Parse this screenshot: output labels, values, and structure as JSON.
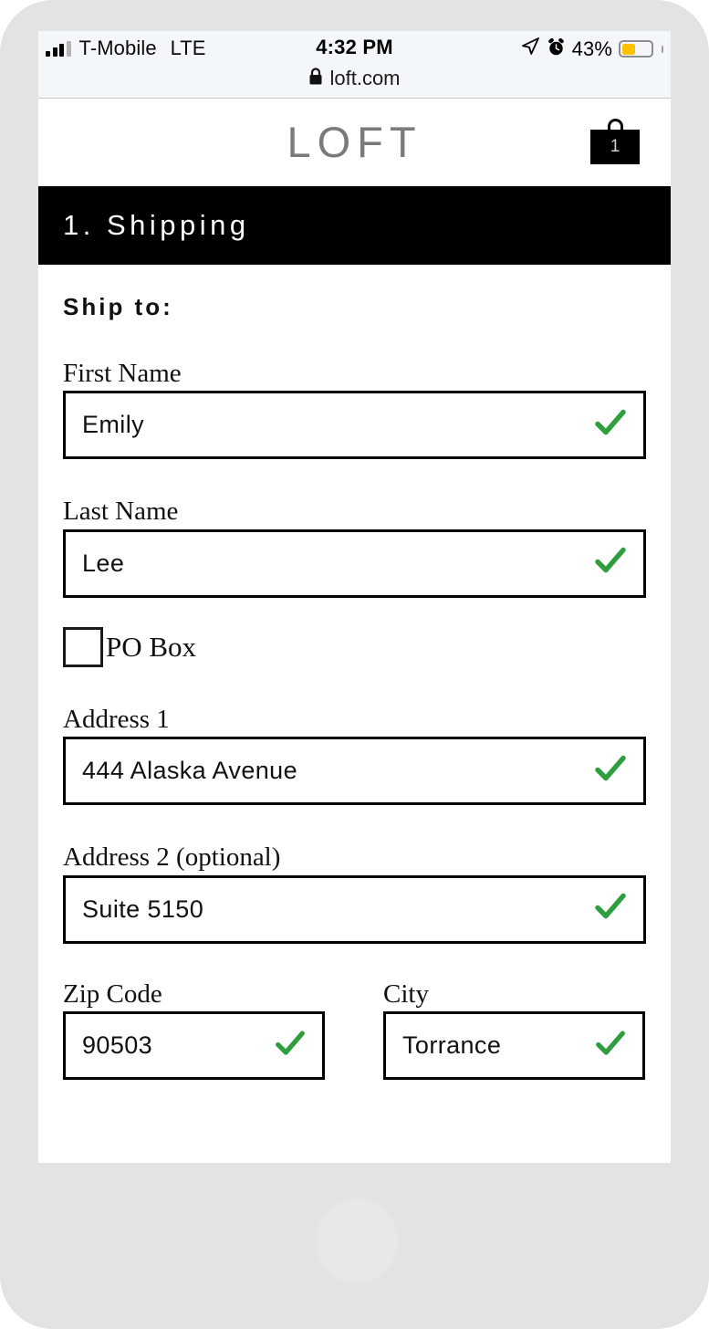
{
  "status_bar": {
    "carrier": "T-Mobile",
    "network": "LTE",
    "time": "4:32 PM",
    "battery_percent": "43%",
    "battery_level": 43,
    "signal_bars_filled": 3,
    "signal_bars_total": 4,
    "location_icon": "location-arrow-icon",
    "alarm_icon": "alarm-clock-icon",
    "battery_color": "#fdc100"
  },
  "browser": {
    "lock_icon": "lock-icon",
    "url": "loft.com"
  },
  "site_header": {
    "brand": "LOFT",
    "brand_color": "#7b7b7b",
    "cart_icon": "shopping-bag-icon",
    "cart_count": "1"
  },
  "step_banner": {
    "title": "1. Shipping",
    "background": "#000000",
    "text_color": "#ffffff"
  },
  "form": {
    "heading": "Ship to:",
    "valid_check_icon": "green-checkmark-icon",
    "valid_check_color": "#2e9e3e",
    "fields": [
      {
        "name": "first-name",
        "label": "First Name",
        "value": "Emily",
        "valid": true
      },
      {
        "name": "last-name",
        "label": "Last Name",
        "value": "Lee",
        "valid": true
      },
      {
        "name": "address-1",
        "label": "Address 1",
        "value": "444 Alaska Avenue",
        "valid": true
      },
      {
        "name": "address-2",
        "label": "Address 2 (optional)",
        "value": "Suite 5150",
        "valid": true
      },
      {
        "name": "zip-code",
        "label": "Zip Code",
        "value": "90503",
        "valid": true
      },
      {
        "name": "city",
        "label": "City",
        "value": "Torrance",
        "valid": true
      }
    ],
    "po_box": {
      "label": "PO Box",
      "checked": false
    }
  }
}
